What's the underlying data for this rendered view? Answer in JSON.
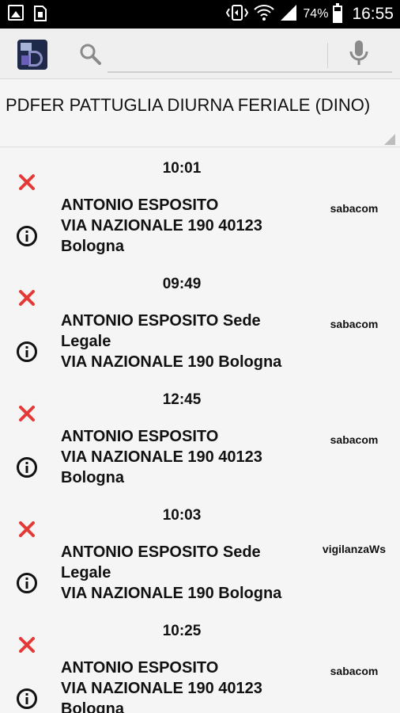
{
  "status_bar": {
    "icons": [
      "image-icon",
      "sim-icon",
      "vibrate-icon",
      "wifi-icon",
      "signal-icon",
      "battery-icon"
    ],
    "battery": "74%",
    "time": "16:55"
  },
  "action_bar": {
    "logo_icon": "app-logo",
    "search_icon": "search-icon",
    "search_value": "",
    "mic_icon": "mic-icon"
  },
  "spinner": {
    "selected": "PDFER PATTUGLIA DIURNA FERIALE (DINO)"
  },
  "colors": {
    "delete_red": "#e53935",
    "text": "#111111",
    "background": "#f5f5f5"
  },
  "items": [
    {
      "time": "10:01",
      "lines": [
        "ANTONIO ESPOSITO",
        "VIA NAZIONALE 190  40123",
        "Bologna"
      ],
      "source": "sabacom"
    },
    {
      "time": "09:49",
      "lines": [
        "ANTONIO ESPOSITO Sede",
        "Legale",
        "VIA NAZIONALE 190 Bologna"
      ],
      "source": "sabacom"
    },
    {
      "time": "12:45",
      "lines": [
        "ANTONIO ESPOSITO",
        "VIA NAZIONALE 190  40123",
        "Bologna"
      ],
      "source": "sabacom"
    },
    {
      "time": "10:03",
      "lines": [
        "ANTONIO ESPOSITO Sede",
        "Legale",
        "VIA NAZIONALE 190 Bologna"
      ],
      "source": "vigilanzaWs"
    },
    {
      "time": "10:25",
      "lines": [
        "ANTONIO ESPOSITO",
        "VIA NAZIONALE 190  40123",
        "Bologna"
      ],
      "source": "sabacom"
    }
  ]
}
